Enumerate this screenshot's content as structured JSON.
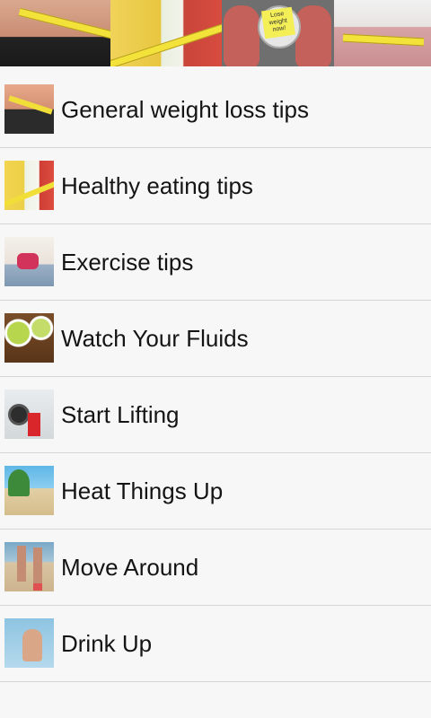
{
  "banner": {
    "tiles": [
      "waist-measure-icon",
      "healthy-food-icon",
      "scale-feet-icon",
      "waist-tape-icon"
    ],
    "note_text": "Lose weight now!"
  },
  "tips": [
    {
      "label": "General weight loss tips",
      "icon": "waist-measure-icon"
    },
    {
      "label": "Healthy eating tips",
      "icon": "smoothie-fruit-icon"
    },
    {
      "label": "Exercise tips",
      "icon": "situp-woman-icon"
    },
    {
      "label": "Watch Your Fluids",
      "icon": "green-tea-icon"
    },
    {
      "label": "Start Lifting",
      "icon": "weightlifting-icon"
    },
    {
      "label": "Heat Things Up",
      "icon": "beach-sun-icon"
    },
    {
      "label": "Move Around",
      "icon": "walking-legs-icon"
    },
    {
      "label": "Drink Up",
      "icon": "woman-drinking-icon"
    }
  ]
}
